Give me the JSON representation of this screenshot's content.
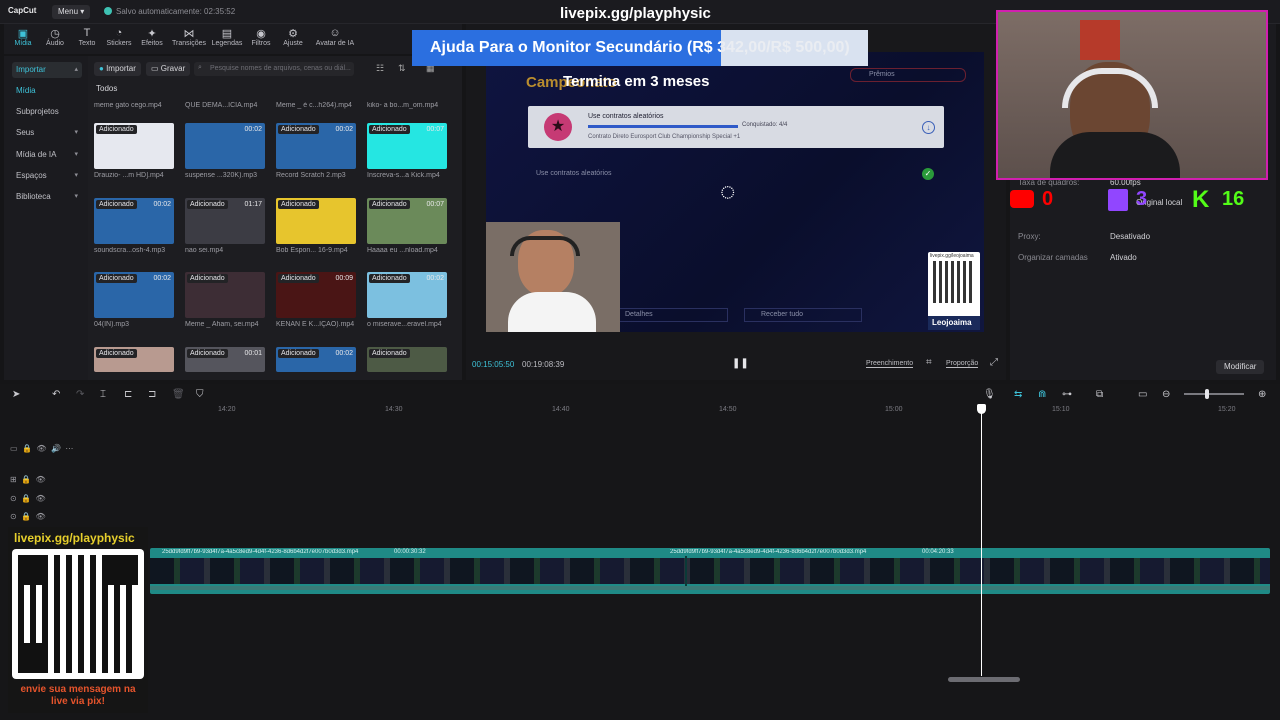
{
  "app": {
    "logo": "CapCut",
    "menu_label": "Menu",
    "autosave": "Salvo automaticamente: 02:35:52",
    "overlay_url": "livepix.gg/playphysic"
  },
  "toolbar": {
    "tools": [
      {
        "label": "Mídia",
        "icon": "media-icon"
      },
      {
        "label": "Áudio",
        "icon": "audio-icon"
      },
      {
        "label": "Texto",
        "icon": "text-icon"
      },
      {
        "label": "Stickers",
        "icon": "stickers-icon"
      },
      {
        "label": "Efeitos",
        "icon": "effects-icon"
      },
      {
        "label": "Transições",
        "icon": "transitions-icon"
      },
      {
        "label": "Legendas",
        "icon": "captions-icon"
      },
      {
        "label": "Filtros",
        "icon": "filters-icon"
      },
      {
        "label": "Ajuste",
        "icon": "adjust-icon"
      },
      {
        "label": "Avatar de IA",
        "icon": "avatar-icon"
      }
    ]
  },
  "leftnav": {
    "items": [
      "Importar",
      "Mídia",
      "Subprojetos",
      "Seus",
      "Mídia de IA",
      "Espaços",
      "Biblioteca"
    ]
  },
  "media": {
    "import_label": "Importar",
    "record_label": "Gravar",
    "search_placeholder": "Pesquise nomes de arquivos, cenas ou diál...",
    "tab_all": "Todos",
    "top_row_captions": [
      "meme gato cego.mp4",
      "QUE DEMA...ÍCIA.mp4",
      "Meme _ é c...h264).mp4",
      "kiko- a bo...m_om.mp4"
    ],
    "items": [
      {
        "badge": "Adicionado",
        "duration": "",
        "caption": "Drauzio- ...m HD].mp4",
        "color": "#e6e8ef"
      },
      {
        "badge": "",
        "duration": "00:02",
        "caption": "suspense ...320K).mp3",
        "color": "#2a66a8"
      },
      {
        "badge": "Adicionado",
        "duration": "00:02",
        "caption": "Record Scratch 2.mp3",
        "color": "#2a66a8"
      },
      {
        "badge": "Adicionado",
        "duration": "00:07",
        "caption": "Inscreva-s...a Kick.mp4",
        "color": "#25e6e2"
      },
      {
        "badge": "Adicionado",
        "duration": "00:02",
        "caption": "soundscra...osh-4.mp3",
        "color": "#2a66a8"
      },
      {
        "badge": "Adicionado",
        "duration": "01:17",
        "caption": "nao sei.mp4",
        "color": "#3c3c44"
      },
      {
        "badge": "Adicionado",
        "duration": "",
        "caption": "Bob Espon... 16-9.mp4",
        "color": "#e7c52d"
      },
      {
        "badge": "Adicionado",
        "duration": "00:07",
        "caption": "Haaaa eu ...nload.mp4",
        "color": "#6b8a5a"
      },
      {
        "badge": "Adicionado",
        "duration": "00:02",
        "caption": "04(IN).mp3",
        "color": "#2a66a8"
      },
      {
        "badge": "Adicionado",
        "duration": "",
        "caption": "Meme _ Aham, sei.mp4",
        "color": "#3d2d35"
      },
      {
        "badge": "Adicionado",
        "duration": "00:09",
        "caption": "KENAN E K...IÇÃO).mp4",
        "color": "#4a1515"
      },
      {
        "badge": "Adicionado",
        "duration": "00:02",
        "caption": "o miserave...eravel.mp4",
        "color": "#7cc0e0"
      },
      {
        "badge": "Adicionado",
        "duration": "",
        "caption": "",
        "color": "#b89a90"
      },
      {
        "badge": "Adicionado",
        "duration": "00:01",
        "caption": "",
        "color": "#55555d"
      },
      {
        "badge": "Adicionado",
        "duration": "00:02",
        "caption": "",
        "color": "#2a66a8"
      },
      {
        "badge": "Adicionado",
        "duration": "",
        "caption": "",
        "color": "#4d5a45"
      }
    ]
  },
  "player": {
    "banner_text": "Ajuda Para o Monitor Secundário (R$ 342,00/R$ 500,00)",
    "subtitle": "Termina em 3 meses",
    "video_heading": "Campeonato",
    "premios": "Prêmios",
    "mission_title": "Use contratos aleatórios",
    "mission_progress": "Conquistado: 4/4",
    "mission_desc": "Contrato Direto Eurosport Club Championship Special +1",
    "mission_row": "Use contratos aleatórios",
    "details": "Detalhes",
    "receive_all": "Receber tudo",
    "qr_url": "livepix.gg/leojoaima",
    "qr_name": "Leojoaima",
    "time_current": "00:15:05:50",
    "time_total": "00:19:08:39",
    "fill_label": "Preenchimento",
    "ratio_label": "Proporção"
  },
  "props": {
    "frame_rate_label": "Taxa de quadros:",
    "frame_rate": "60.00fps",
    "local_label": "Original local",
    "proxy_label": "Proxy:",
    "proxy_val": "Desativado",
    "layers_label": "Organizar camadas",
    "layers_val": "Ativado",
    "modify": "Modificar",
    "stats": [
      {
        "icon": "youtube-icon",
        "value": "0",
        "color": "#ff0000"
      },
      {
        "icon": "twitch-icon",
        "value": "3",
        "color": "#9146ff"
      },
      {
        "icon": "kick-icon",
        "value": "16",
        "color": "#53fc18"
      }
    ]
  },
  "timeline": {
    "ruler": [
      "14:20",
      "14:30",
      "14:40",
      "14:50",
      "15:00",
      "15:10",
      "15:20"
    ],
    "clip1_name": "25dd9fd9ff7b9-93d4f7a-4a5c8ed9-4d4f-4236-8d6b4d2f7e007b0d3d3.mp4",
    "clip1_time": "00:00:30:32",
    "clip2_name": "25dd9fd9ff7b9-93d4f7a-4a5c8ed9-4d4f-4236-8d6b4d2f7e007b0d3d3.mp4",
    "clip2_time": "00:04:20:33"
  },
  "overlay": {
    "qr_url": "livepix.gg/playphysic",
    "qr_msg": "envie sua mensagem na live via pix!"
  }
}
